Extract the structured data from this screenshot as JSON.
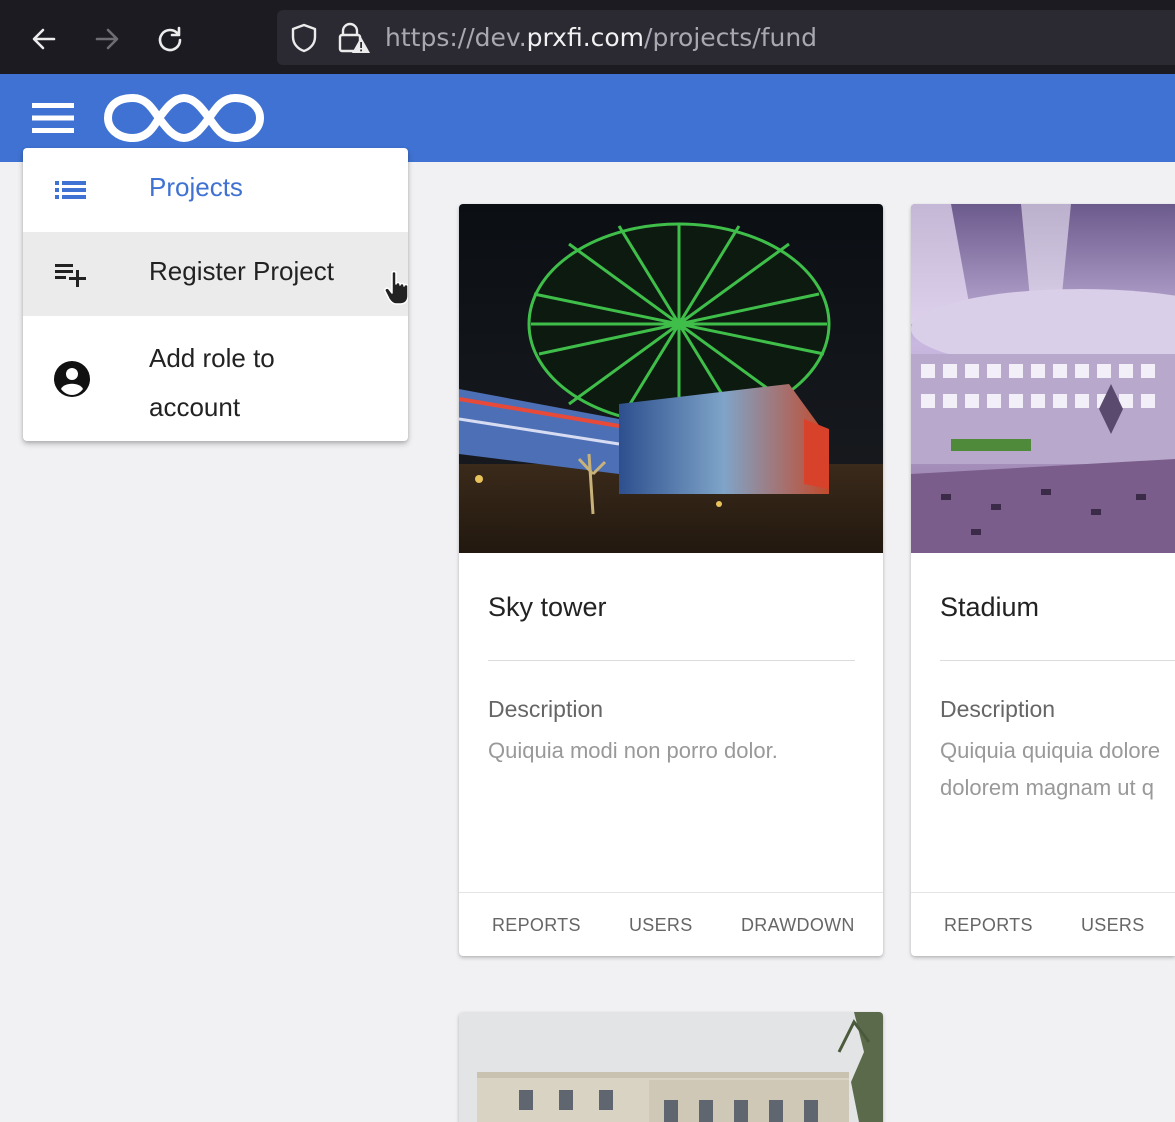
{
  "browser": {
    "url_prefix": "https://dev.",
    "url_host": "prxfi.com",
    "url_path": "/projects/fund"
  },
  "menu": {
    "items": [
      {
        "label": "Projects",
        "icon": "list-icon"
      },
      {
        "label": "Register Project",
        "icon": "playlist-add-icon"
      },
      {
        "label": "Add role to account",
        "icon": "account-circle-icon"
      }
    ]
  },
  "projects": [
    {
      "title": "Sky tower",
      "description_label": "Description",
      "description": "Quiquia modi non porro dolor.",
      "actions": [
        "REPORTS",
        "USERS",
        "DRAWDOWN"
      ]
    },
    {
      "title": "Stadium",
      "description_label": "Description",
      "description_line1": "Quiquia quiquia dolore",
      "description_line2": "dolorem magnam ut q",
      "actions": [
        "REPORTS",
        "USERS"
      ]
    }
  ],
  "colors": {
    "primary": "#3f72d2",
    "background": "#f1f1f3",
    "browser_chrome": "#1c1b22"
  }
}
